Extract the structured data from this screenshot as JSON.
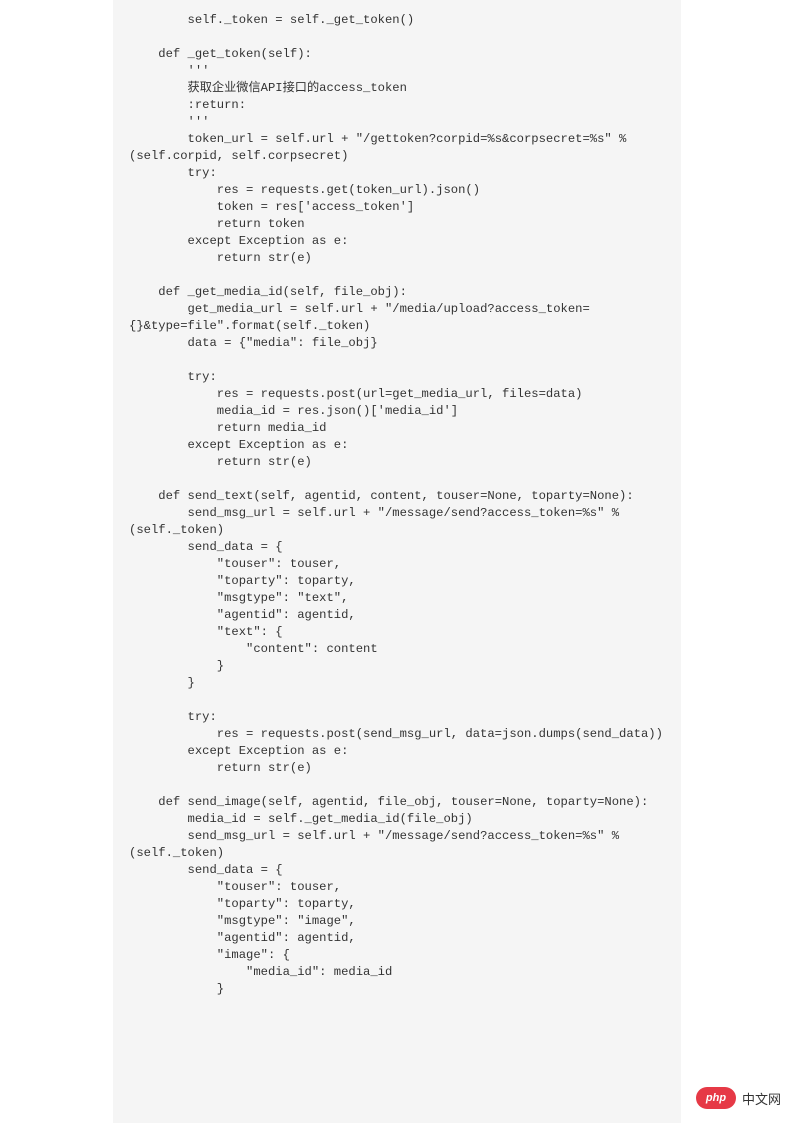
{
  "code": "        self._token = self._get_token()\n\n    def _get_token(self):\n        '''\n        获取企业微信API接口的access_token\n        :return:\n        '''\n        token_url = self.url + \"/gettoken?corpid=%s&corpsecret=%s\" %(self.corpid, self.corpsecret)\n        try:\n            res = requests.get(token_url).json()\n            token = res['access_token']\n            return token\n        except Exception as e:\n            return str(e)\n\n    def _get_media_id(self, file_obj):\n        get_media_url = self.url + \"/media/upload?access_token={}&type=file\".format(self._token)\n        data = {\"media\": file_obj}\n\n        try:\n            res = requests.post(url=get_media_url, files=data)\n            media_id = res.json()['media_id']\n            return media_id\n        except Exception as e:\n            return str(e)\n\n    def send_text(self, agentid, content, touser=None, toparty=None):\n        send_msg_url = self.url + \"/message/send?access_token=%s\" %(self._token)\n        send_data = {\n            \"touser\": touser,\n            \"toparty\": toparty,\n            \"msgtype\": \"text\",\n            \"agentid\": agentid,\n            \"text\": {\n                \"content\": content\n            }\n        }\n\n        try:\n            res = requests.post(send_msg_url, data=json.dumps(send_data))\n        except Exception as e:\n            return str(e)\n\n    def send_image(self, agentid, file_obj, touser=None, toparty=None):\n        media_id = self._get_media_id(file_obj)\n        send_msg_url = self.url + \"/message/send?access_token=%s\" %(self._token)\n        send_data = {\n            \"touser\": touser,\n            \"toparty\": toparty,\n            \"msgtype\": \"image\",\n            \"agentid\": agentid,\n            \"image\": {\n                \"media_id\": media_id\n            }",
  "watermark": {
    "logo_text": "php",
    "site_text": "中文网"
  }
}
